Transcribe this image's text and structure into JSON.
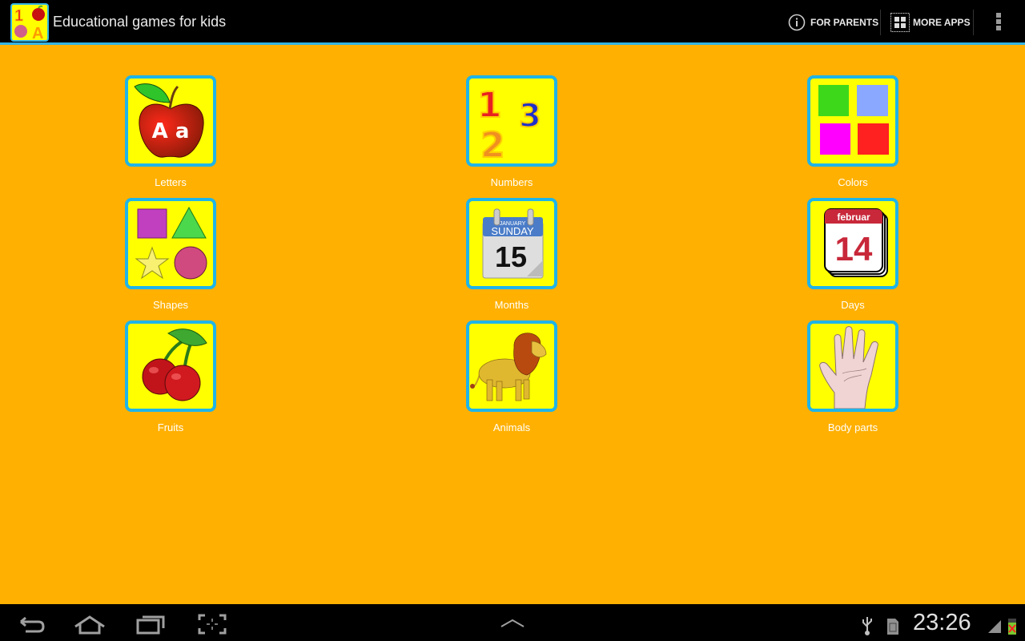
{
  "app": {
    "title": "Educational games for kids",
    "logo_icon": "app-logo-icon",
    "accent_color": "#33b5e5",
    "background_color": "#ffb000"
  },
  "actionbar": {
    "for_parents_label": "FOR PARENTS",
    "for_parents_icon": "info-icon",
    "more_apps_label": "MORE APPS",
    "more_apps_icon": "grid-icon",
    "overflow_icon": "overflow-menu-icon"
  },
  "categories": [
    {
      "label": "Letters",
      "icon": "apple-letters-icon"
    },
    {
      "label": "Numbers",
      "icon": "numbers-icon"
    },
    {
      "label": "Colors",
      "icon": "color-squares-icon"
    },
    {
      "label": "Shapes",
      "icon": "shapes-icon"
    },
    {
      "label": "Months",
      "icon": "calendar-icon"
    },
    {
      "label": "Days",
      "icon": "day-calendar-icon"
    },
    {
      "label": "Fruits",
      "icon": "cherries-icon"
    },
    {
      "label": "Animals",
      "icon": "lion-icon"
    },
    {
      "label": "Body parts",
      "icon": "hand-icon"
    }
  ],
  "icon_text": {
    "letters": "A a",
    "months_month": "JANUARY",
    "months_day": "SUNDAY",
    "months_date": "15",
    "days_month": "februar",
    "days_date": "14"
  },
  "systembar": {
    "clock": "23:26",
    "back_icon": "back-icon",
    "home_icon": "home-icon",
    "recents_icon": "recent-apps-icon",
    "screenshot_icon": "screenshot-icon",
    "up_icon": "chevron-up-icon",
    "usb_icon": "usb-icon",
    "sd_icon": "sd-card-icon",
    "signal_icon": "signal-icon",
    "battery_icon": "battery-icon"
  }
}
